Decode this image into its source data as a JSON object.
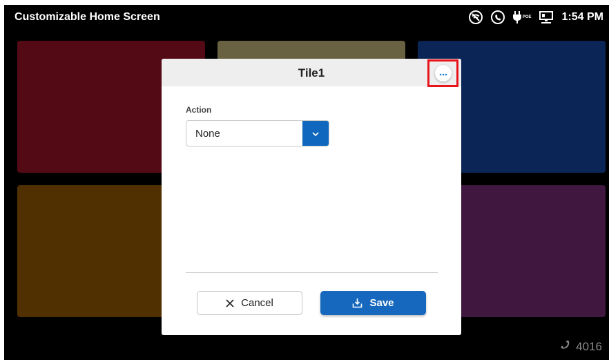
{
  "app": {
    "title": "Customizable Home Screen"
  },
  "status": {
    "time": "1:54 PM",
    "icons": [
      "no-wifi-icon",
      "phone-icon",
      "poe-power-icon",
      "network-icon"
    ],
    "poe_label": "POE"
  },
  "tiles": [
    {
      "color": "#540a15"
    },
    {
      "color": "#686142"
    },
    {
      "color": "#0b2656"
    },
    {
      "color": "#502f00"
    },
    {
      "color": "#40173f"
    }
  ],
  "footer": {
    "extension": "4016",
    "icon": "phone-handset-icon"
  },
  "dialog": {
    "title": "Tile1",
    "more_icon": "more-horizontal-icon",
    "action_label": "Action",
    "action_value": "None",
    "cancel_label": "Cancel",
    "save_label": "Save"
  },
  "colors": {
    "accent": "#1568bd",
    "highlight": "#e8131b",
    "header": "#eeeeee"
  }
}
